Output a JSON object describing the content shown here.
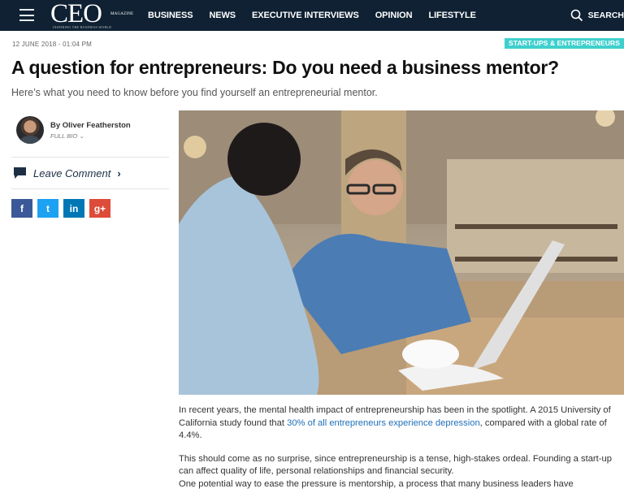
{
  "header": {
    "logo_text": "CEO",
    "logo_small": "MAGAZINE",
    "logo_tagline": "INSPIRING THE BUSINESS WORLD",
    "nav": [
      "BUSINESS",
      "NEWS",
      "EXECUTIVE INTERVIEWS",
      "OPINION",
      "LIFESTYLE"
    ],
    "search_label": "SEARCH",
    "icons": {
      "menu": "hamburger-icon",
      "search": "search-icon"
    }
  },
  "article": {
    "date": "12 JUNE 2018 - 01:04 PM",
    "category": "START-UPS & ENTREPRENEURS",
    "title": "A question for entrepreneurs: Do you need a business mentor?",
    "subtitle": "Here’s what you need to know before you find yourself an entrepreneurial mentor.",
    "author": {
      "byline": "By Oliver Featherston",
      "bio_link": "FULL BIO"
    },
    "comment": {
      "label": "Leave Comment",
      "icon": "speech-bubble-icon"
    },
    "share": [
      {
        "label": "f",
        "icon": "facebook-icon",
        "color": "#3b5998"
      },
      {
        "label": "t",
        "icon": "twitter-icon",
        "color": "#1da1f2"
      },
      {
        "label": "in",
        "icon": "linkedin-icon",
        "color": "#0077b5"
      },
      {
        "label": "g+",
        "icon": "google-plus-icon",
        "color": "#dd4b39"
      }
    ],
    "body": {
      "p1_before": "In recent years, the mental health impact of entrepreneurship has been in the spotlight. A 2015 University of California study found that ",
      "p1_link": "30% of all entrepreneurs experience depression",
      "p1_after": ", compared with a global rate of 4.4%.",
      "p2": "This should come as no surprise, since entrepreneurship is a tense, high-stakes ordeal. Founding a start-up can affect quality of life, personal relationships and financial security.",
      "p3": "One potential way to ease the pressure is mentorship, a process that many business leaders have"
    }
  },
  "colors": {
    "header_bg": "#0f2133",
    "category_bg": "#3fd0ce",
    "link": "#1f6fb8"
  }
}
